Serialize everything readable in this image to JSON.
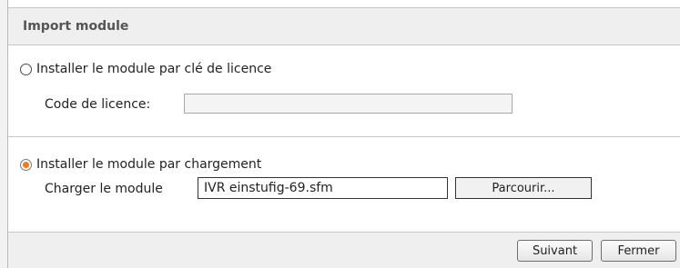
{
  "dialog": {
    "title": "Import module"
  },
  "licence_option": {
    "label": "Installer le module par clé de licence",
    "selected": false,
    "field_label": "Code de licence:",
    "field_value": ""
  },
  "upload_option": {
    "label": "Installer le module par chargement",
    "selected": true,
    "field_label": "Charger le module",
    "file_value": "IVR einstufig-69.sfm",
    "browse_label": "Parcourir..."
  },
  "footer": {
    "next_label": "Suivant",
    "close_label": "Fermer"
  },
  "colors": {
    "radio_selected": "#f07a1e",
    "title_bar_bg": "#efefef",
    "border": "#c6c6c6"
  }
}
